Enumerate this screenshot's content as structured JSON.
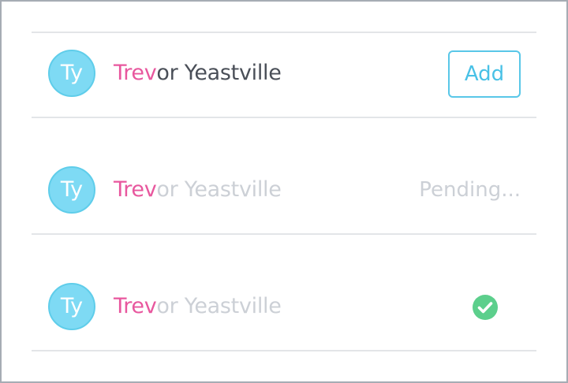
{
  "rows": [
    {
      "avatar_initials": "Ty",
      "name_match": "Trev",
      "name_rest": "or Yeastville",
      "action_label": "Add"
    },
    {
      "avatar_initials": "Ty",
      "name_match": "Trev",
      "name_rest": "or Yeastville",
      "status_label": "Pending..."
    },
    {
      "avatar_initials": "Ty",
      "name_match": "Trev",
      "name_rest": "or Yeastville",
      "status_icon": "check-circle-icon"
    }
  ],
  "colors": {
    "highlight": "#e8579e",
    "avatar": "#7edaf4",
    "accent": "#49c1e6",
    "success": "#5ccf8c",
    "muted_text": "#ccd0d6",
    "text": "#4a4f58"
  }
}
